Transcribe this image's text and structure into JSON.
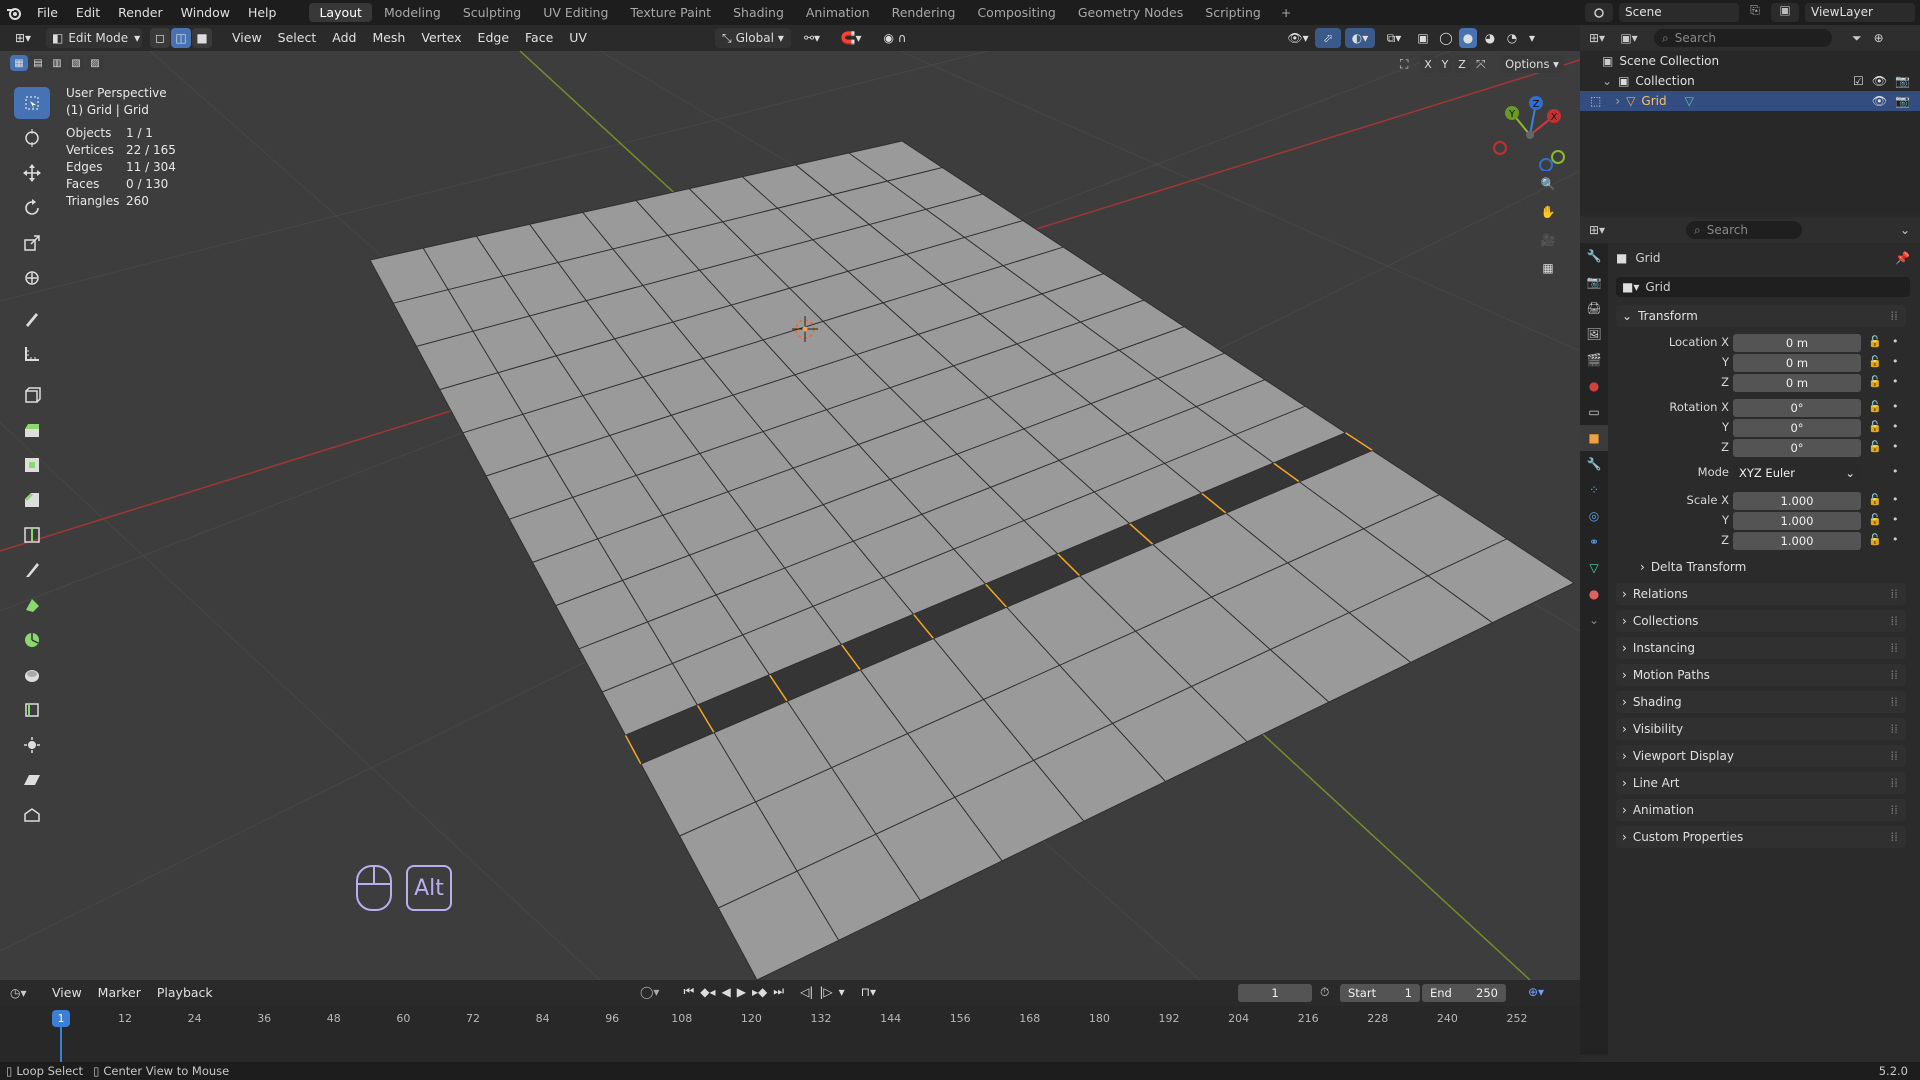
{
  "top_menu": {
    "items": [
      "File",
      "Edit",
      "Render",
      "Window",
      "Help"
    ],
    "workspaces": [
      "Layout",
      "Modeling",
      "Sculpting",
      "UV Editing",
      "Texture Paint",
      "Shading",
      "Animation",
      "Rendering",
      "Compositing",
      "Geometry Nodes",
      "Scripting"
    ],
    "active_workspace": "Layout",
    "add_tab": "+",
    "scene": "Scene",
    "view_layer": "ViewLayer"
  },
  "viewport_header": {
    "mode": "Edit Mode",
    "menus": [
      "View",
      "Select",
      "Add",
      "Mesh",
      "Vertex",
      "Edge",
      "Face",
      "UV"
    ],
    "orientation": "Global",
    "options": "Options",
    "axes": [
      "X",
      "Y",
      "Z"
    ]
  },
  "viewport_info": {
    "perspective": "User Perspective",
    "object": "(1) Grid | Grid",
    "stats": [
      {
        "k": "Objects",
        "v": "1 / 1"
      },
      {
        "k": "Vertices",
        "v": "22 / 165"
      },
      {
        "k": "Edges",
        "v": "11 / 304"
      },
      {
        "k": "Faces",
        "v": "0 / 130"
      },
      {
        "k": "Triangles",
        "v": "260"
      }
    ],
    "key_hint": "Alt"
  },
  "gizmo": {
    "x": "X",
    "y": "Y",
    "z": "Z"
  },
  "outliner": {
    "search_placeholder": "Search",
    "scene_collection": "Scene Collection",
    "collection": "Collection",
    "object": "Grid"
  },
  "properties": {
    "search_placeholder": "Search",
    "object_name": "Grid",
    "data_name": "Grid",
    "transform_title": "Transform",
    "location_label": "Location X",
    "rotation_label": "Rotation X",
    "scale_label": "Scale X",
    "axis_y": "Y",
    "axis_z": "Z",
    "location": [
      "0 m",
      "0 m",
      "0 m"
    ],
    "rotation": [
      "0°",
      "0°",
      "0°"
    ],
    "mode_label": "Mode",
    "mode_value": "XYZ Euler",
    "scale": [
      "1.000",
      "1.000",
      "1.000"
    ],
    "delta": "Delta Transform",
    "panels": [
      "Relations",
      "Collections",
      "Instancing",
      "Motion Paths",
      "Shading",
      "Visibility",
      "Viewport Display",
      "Line Art",
      "Animation",
      "Custom Properties"
    ]
  },
  "timeline": {
    "menus": [
      "View",
      "Marker",
      "Playback"
    ],
    "current_frame": "1",
    "start_label": "Start",
    "start": "1",
    "end_label": "End",
    "end": "250",
    "ticks": [
      "12",
      "24",
      "36",
      "48",
      "60",
      "72",
      "84",
      "96",
      "108",
      "120",
      "132",
      "144",
      "156",
      "168",
      "180",
      "192",
      "204",
      "216",
      "228",
      "240",
      "252"
    ],
    "playhead": "1"
  },
  "status_bar": {
    "left1": "Loop Select",
    "left2": "Center View to Mouse",
    "version": "5.2.0"
  },
  "colors": {
    "accent": "#4772b3",
    "selected_edge": "#f5a623",
    "x_axis": "#d23b3b",
    "y_axis": "#8bba2f",
    "z_axis": "#3d82e0"
  }
}
